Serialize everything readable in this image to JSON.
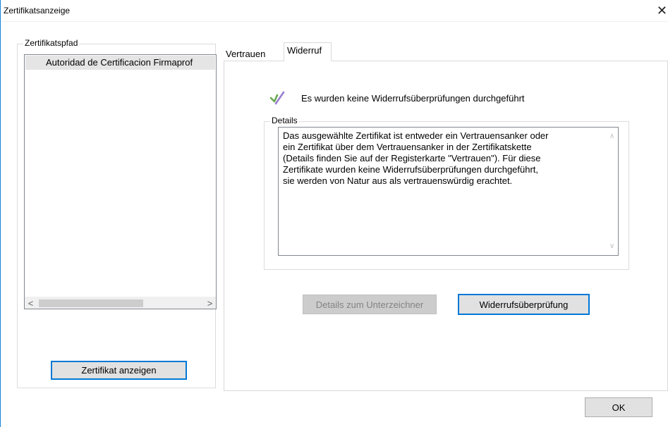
{
  "window": {
    "title": "Zertifikatsanzeige",
    "close_glyph": "✕"
  },
  "path_group": {
    "legend": "Zertifikatspfad",
    "items": [
      {
        "label": "Autoridad de Certificacion Firmaprof"
      }
    ],
    "scroll_left": "<",
    "scroll_right": ">",
    "show_cert_label": "Zertifikat anzeigen"
  },
  "tabs": [
    {
      "label": "Vertrauen",
      "selected": false
    },
    {
      "label": "Widerruf",
      "selected": true
    }
  ],
  "revocation": {
    "status_text": "Es wurden keine Widerrufsüberprüfungen durchgeführt",
    "status_icon": "check-icon",
    "details_legend": "Details",
    "details_text": "Das ausgewählte Zertifikat ist entweder ein Vertrauensanker oder\nein Zertifikat über dem Vertrauensanker in der Zertifikatskette\n(Details finden Sie auf der Registerkarte \"Vertrauen\"). Für diese\nZertifikate wurden keine Widerrufsüberprüfungen durchgeführt,\nsie werden von Natur aus als vertrauenswürdig erachtet.",
    "scroll_up": "∧",
    "scroll_down": "∨",
    "signer_details_label": "Details zum Unterzeichner",
    "revocation_check_label": "Widerrufsüberprüfung"
  },
  "footer": {
    "ok_label": "OK"
  },
  "colors": {
    "accent": "#0078d7",
    "window_border": "#1883d7",
    "check_green": "#6aa84f",
    "check_purple": "#9a7fd1"
  }
}
